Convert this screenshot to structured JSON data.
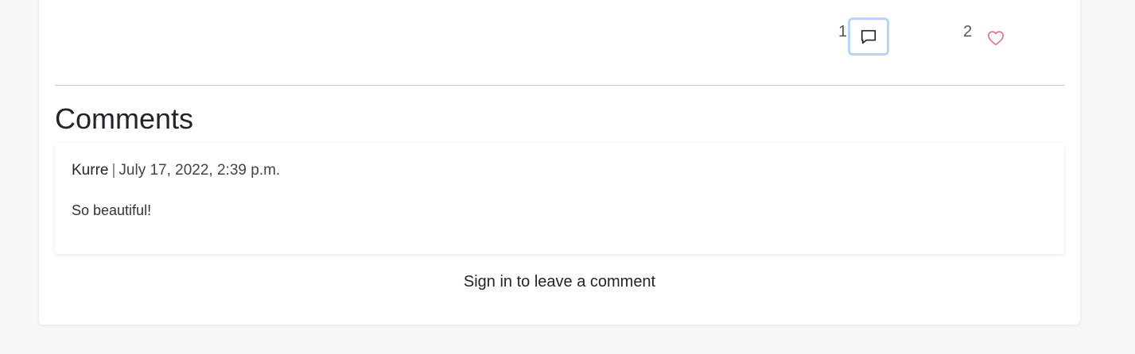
{
  "post_stats": {
    "comment_count": "1",
    "like_count": "2",
    "comment_icon": "chat-bubble-icon",
    "like_icon": "heart-outline-icon",
    "like_color": "#d9778f",
    "comment_focus_color": "#b9d3f5"
  },
  "comments_section": {
    "heading": "Comments",
    "comments": [
      {
        "author": "Kurre",
        "separator": "|",
        "date": "July 17, 2022, 2:39 p.m.",
        "body": "So beautiful!"
      }
    ],
    "sign_in_text": "Sign in to leave a comment"
  }
}
